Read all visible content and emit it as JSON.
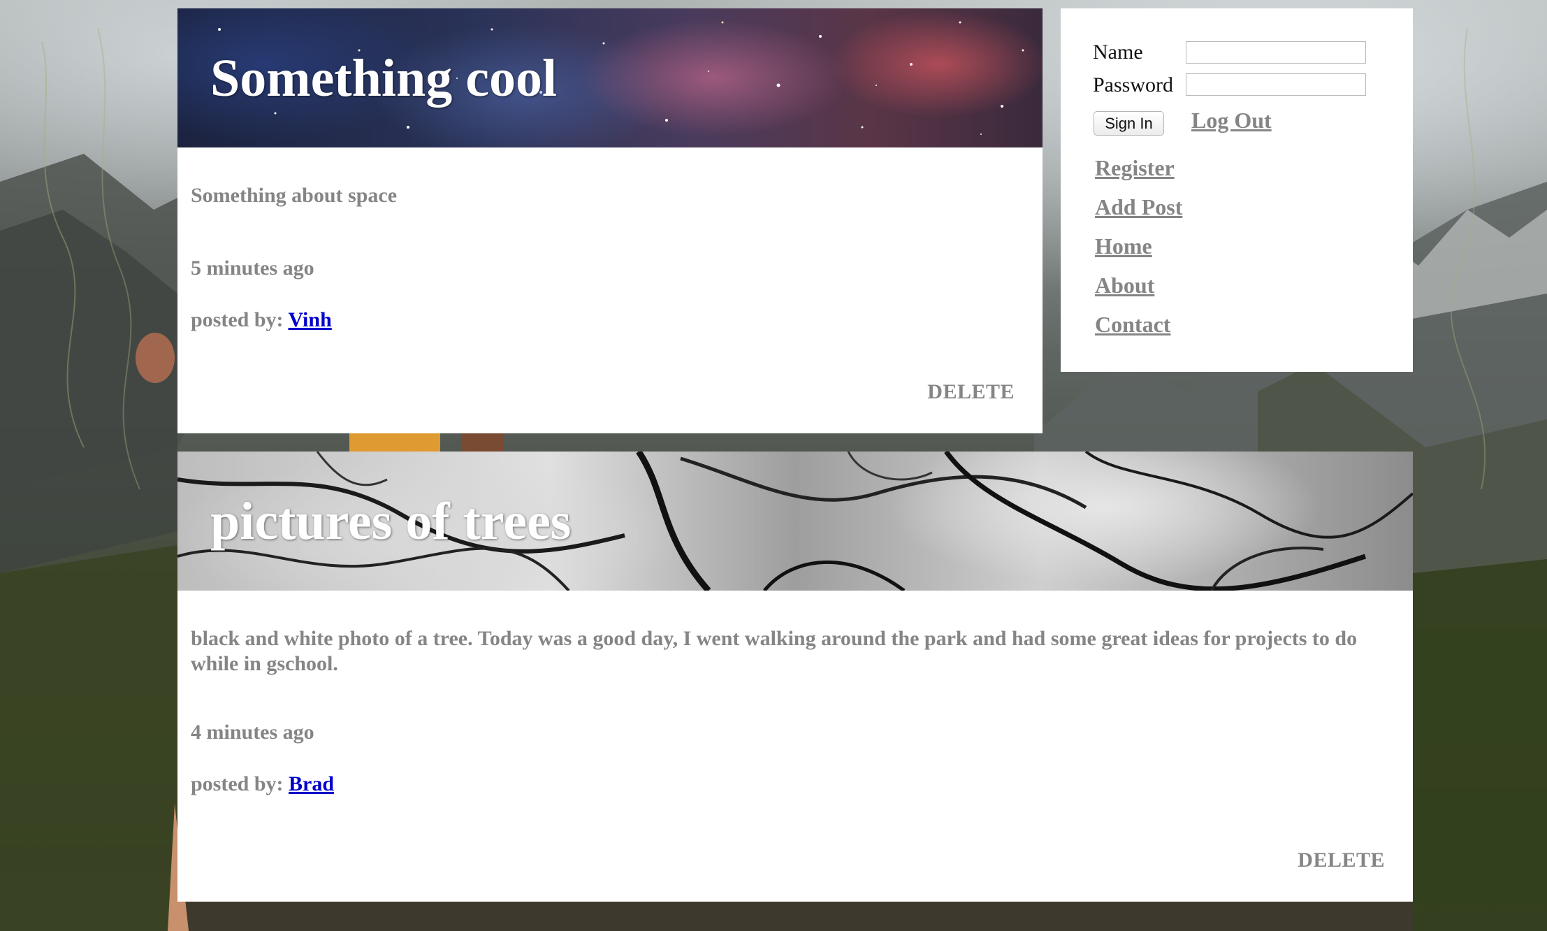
{
  "colors": {
    "card_background": "#ffffff",
    "muted_text": "#858585",
    "link_blue": "#0000cc",
    "title_white": "#ffffff"
  },
  "posts": [
    {
      "title": "Something cool",
      "banner": "space-nebula-image",
      "description": "Something about space",
      "time": "5 minutes ago",
      "posted_by_label": "posted by:",
      "author": "Vinh",
      "delete_label": "DELETE"
    },
    {
      "title": "pictures of trees",
      "banner": "black-and-white-trees-image",
      "description": "black and white photo of a tree. Today was a good day, I went walking around the park and had some great ideas for projects to do while in gschool.",
      "time": "4 minutes ago",
      "posted_by_label": "posted by:",
      "author": "Brad",
      "delete_label": "DELETE"
    }
  ],
  "login": {
    "name_label": "Name",
    "password_label": "Password",
    "name_value": "",
    "password_value": "",
    "sign_in_label": "Sign In",
    "log_out_label": "Log Out"
  },
  "nav": {
    "items": [
      {
        "label": "Register"
      },
      {
        "label": "Add Post"
      },
      {
        "label": "Home"
      },
      {
        "label": "About"
      },
      {
        "label": "Contact"
      }
    ]
  },
  "background": {
    "description_icon": "mountain-landscape-background"
  }
}
